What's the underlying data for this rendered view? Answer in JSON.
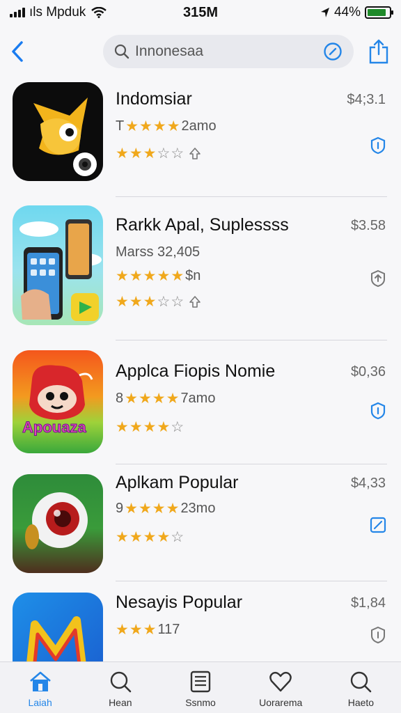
{
  "status_bar": {
    "carrier": "ıls Mpduk",
    "time": "315M",
    "battery_text": "44%",
    "battery_level": 0.85
  },
  "nav": {
    "back_icon": "chevron-left-icon",
    "search_placeholder": "Innonesaa",
    "compass_icon": "compass-icon",
    "share_icon": "share-icon"
  },
  "apps": [
    {
      "title": "Indomsiar",
      "subtitle_prefix": "T",
      "subtitle_suffix": "2amo",
      "price": "$4;3.1",
      "sub_stars": 4,
      "rating": 3,
      "action_icon": "shield-icon"
    },
    {
      "title": "Rarkk  Apal, Suplessss",
      "subtitle_prefix": "Marss 32,405",
      "subtitle_suffix": "",
      "sub_line_two": "$n",
      "price": "$3.58",
      "sub_stars": 5,
      "rating": 3,
      "action_icon": "shield-icon"
    },
    {
      "title": "Applca Fiopis  Nomie",
      "subtitle_prefix": "8",
      "subtitle_suffix": "7amo",
      "price": "$0,36",
      "sub_stars": 4,
      "rating": 3.5,
      "action_icon": "shield-icon"
    },
    {
      "title": "Aplkam Popular",
      "subtitle_prefix": "9",
      "subtitle_suffix": "23mo",
      "price": "$4,33",
      "sub_stars": 4,
      "rating": 4,
      "action_icon": "edit-icon"
    },
    {
      "title": "Nesayis Popular",
      "subtitle_prefix": "",
      "subtitle_suffix": "117",
      "price": "$1,84",
      "sub_stars": 3,
      "rating": 3,
      "action_icon": "shield-icon"
    }
  ],
  "tabs": [
    {
      "label": "Laiah",
      "icon": "home-icon",
      "active": true
    },
    {
      "label": "Hean",
      "icon": "search-icon",
      "active": false
    },
    {
      "label": "Ssnmo",
      "icon": "list-icon",
      "active": false
    },
    {
      "label": "Uorarema",
      "icon": "heart-icon",
      "active": false
    },
    {
      "label": "Haeto",
      "icon": "search-icon",
      "active": false
    }
  ],
  "colors": {
    "accent": "#2486e8",
    "star": "#f0a81c",
    "battery": "#1f8a2a"
  }
}
